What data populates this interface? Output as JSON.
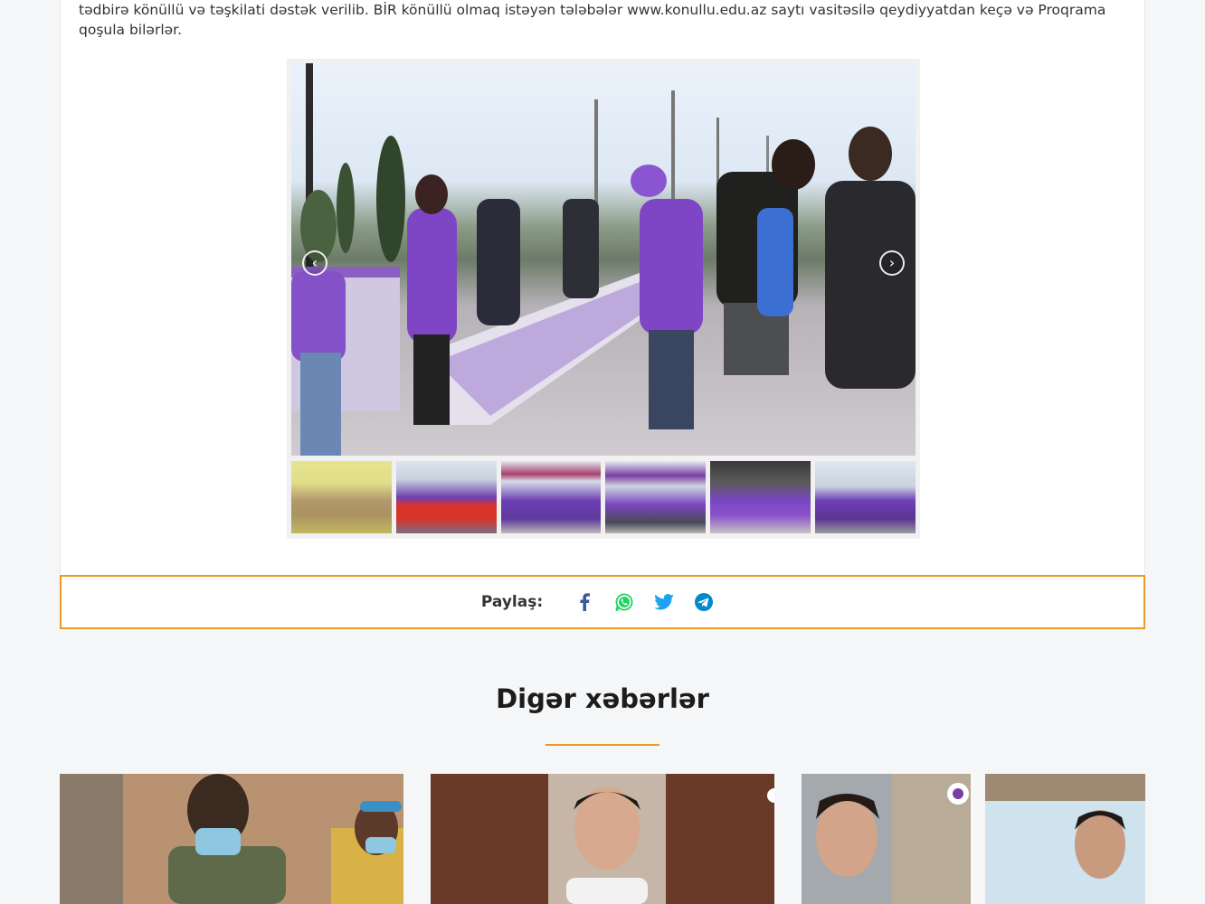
{
  "article": {
    "paragraph": "tədbirə könüllü və təşkilati dəstək verilib. BİR könüllü olmaq istəyən tələbələr www.konullu.edu.az saytı vasitəsilə qeydiyyatdan keçə və Proqrama qoşula bilərlər."
  },
  "gallery": {
    "prev_arrow": "‹",
    "next_arrow": "›",
    "thumbnail_count": 6,
    "active_thumbnail": 1
  },
  "share": {
    "label": "Paylaş:",
    "icons": [
      "facebook-icon",
      "whatsapp-icon",
      "twitter-icon",
      "telegram-icon"
    ],
    "colors": {
      "facebook": "#3b5998",
      "whatsapp": "#25d366",
      "twitter": "#1da1f2",
      "telegram": "#0088cc",
      "border": "#ec9a23"
    }
  },
  "other_news": {
    "title": "Digər xəbərlər",
    "accent": "#ec9a23"
  }
}
